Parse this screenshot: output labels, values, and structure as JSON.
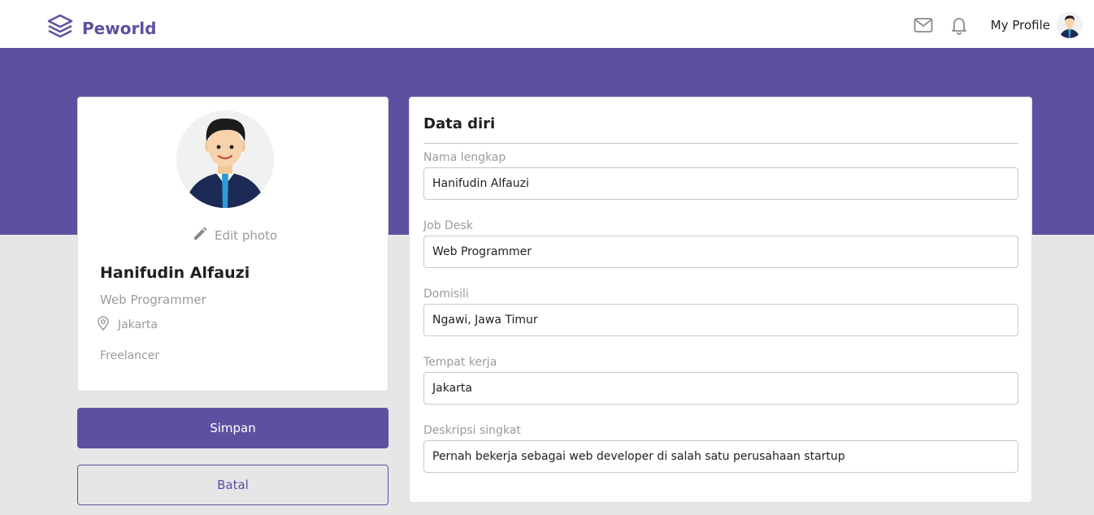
{
  "app": {
    "brand": "Peworld"
  },
  "navbar": {
    "icons": [
      "mail-icon",
      "bell-icon"
    ],
    "profile_label": "My Profile"
  },
  "colors": {
    "primary": "#5e50a1",
    "muted": "#9b9b9b",
    "background": "#e6e6e6"
  },
  "profile": {
    "edit_photo_label": "Edit photo",
    "name": "Hanifudin Alfauzi",
    "job": "Web Programmer",
    "location": "Jakarta",
    "employment_type": "Freelancer"
  },
  "actions": {
    "save_label": "Simpan",
    "cancel_label": "Batal"
  },
  "form": {
    "title": "Data diri",
    "fields": [
      {
        "label": "Nama lengkap",
        "value": "Hanifudin Alfauzi"
      },
      {
        "label": "Job Desk",
        "value": "Web Programmer"
      },
      {
        "label": "Domisili",
        "value": "Ngawi, Jawa Timur"
      },
      {
        "label": "Tempat kerja",
        "value": "Jakarta"
      },
      {
        "label": "Deskripsi singkat",
        "value": "Pernah bekerja sebagai web developer di salah satu perusahaan startup"
      }
    ]
  }
}
